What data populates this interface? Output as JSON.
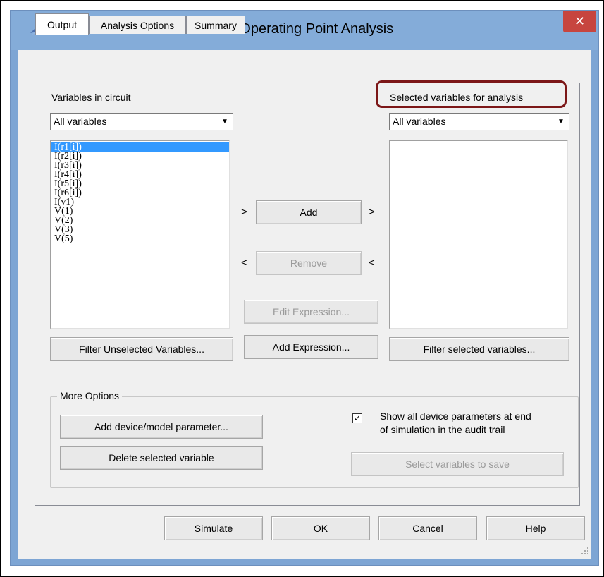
{
  "window": {
    "title": "DC Operating Point Analysis",
    "close_symbol": "✕",
    "icon": "app-logo-icon"
  },
  "tabs": [
    {
      "label": "Output",
      "active": true
    },
    {
      "label": "Analysis Options",
      "active": false
    },
    {
      "label": "Summary",
      "active": false
    }
  ],
  "left_panel": {
    "label": "Variables in circuit",
    "filter_value": "All variables",
    "items": [
      "I(r1[i])",
      "I(r2[i])",
      "I(r3[i])",
      "I(r4[i])",
      "I(r5[i])",
      "I(r6[i])",
      "I(v1)",
      "V(1)",
      "V(2)",
      "V(3)",
      "V(5)"
    ],
    "selected_index": 0,
    "filter_button": "Filter Unselected Variables..."
  },
  "right_panel": {
    "label": "Selected variables for analysis",
    "filter_value": "All variables",
    "items": [],
    "filter_button": "Filter selected variables..."
  },
  "middle": {
    "add_label": "Add",
    "add_left_chevron": ">",
    "add_right_chevron": ">",
    "remove_label": "Remove",
    "remove_left_chevron": "<",
    "remove_right_chevron": "<",
    "edit_expression_label": "Edit Expression...",
    "add_expression_label": "Add Expression..."
  },
  "more_options": {
    "group_label": "More Options",
    "add_param_button": "Add device/model parameter...",
    "delete_button": "Delete selected variable",
    "checkbox_checked": true,
    "checkbox_mark": "✓",
    "checkbox_line1": "Show all device parameters at end",
    "checkbox_line2": "of simulation in the audit trail",
    "select_save_button": "Select variables to save"
  },
  "footer": {
    "simulate": "Simulate",
    "ok": "OK",
    "cancel": "Cancel",
    "help": "Help"
  },
  "colors": {
    "title_bar": "#84acd9",
    "close_button": "#c7453f",
    "selection": "#3399ff",
    "highlight_outline": "#7c1718"
  }
}
